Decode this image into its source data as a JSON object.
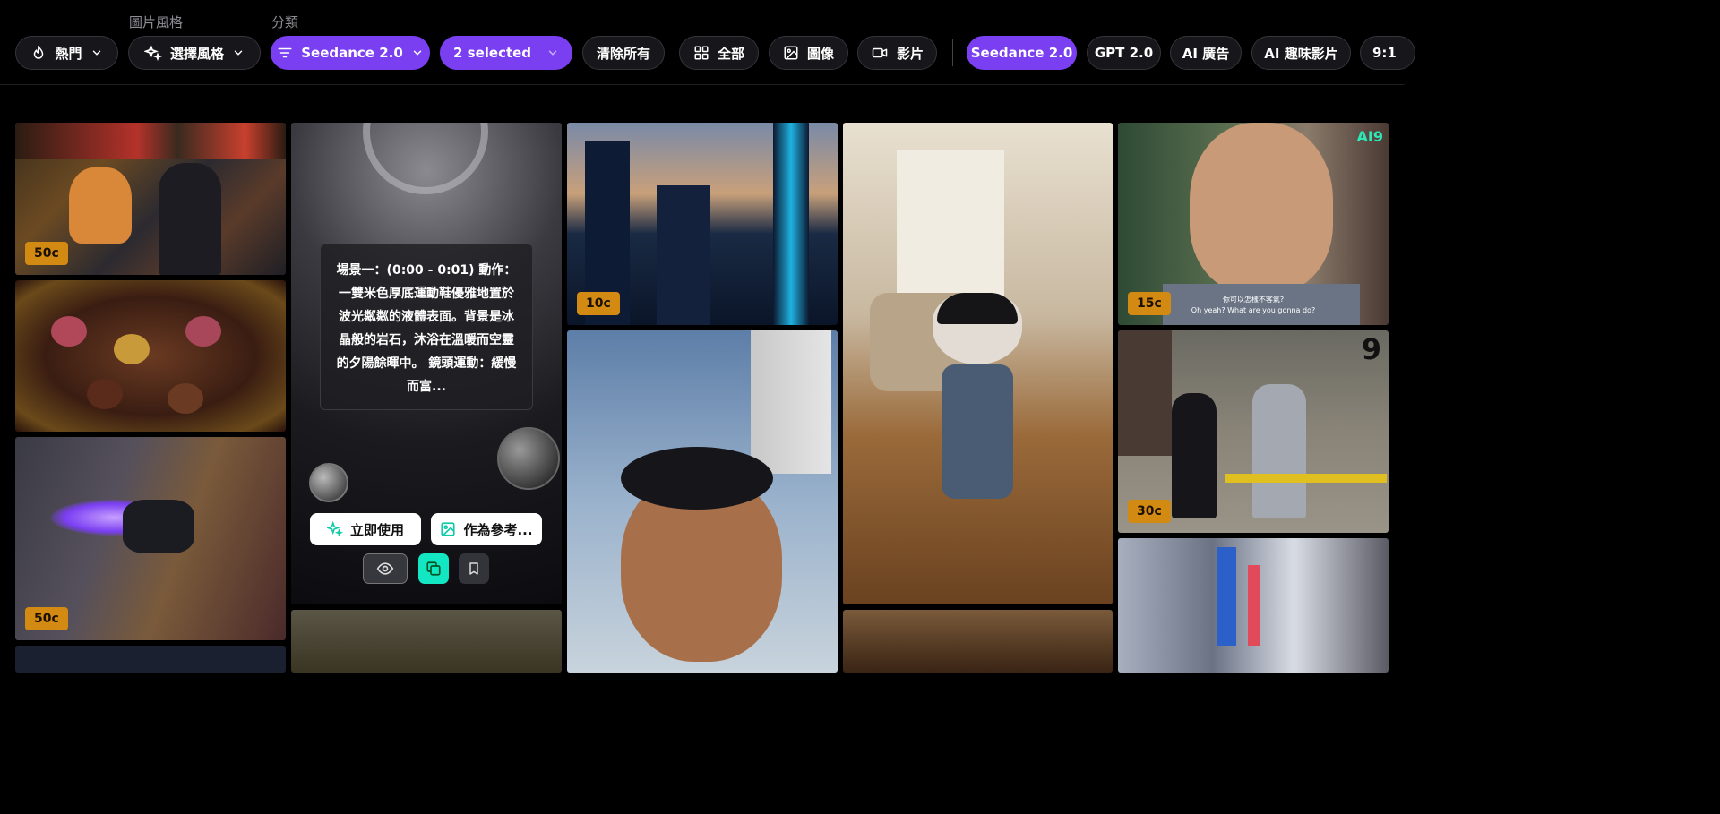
{
  "filters": {
    "style_group_label": "圖片風格",
    "category_group_label": "分類",
    "sort_label": "熱門",
    "style_select_label": "選擇風格",
    "model_select_label": "Seedance 2.0",
    "multi_select_label": "2 selected",
    "clear_all_label": "清除所有",
    "type_all_label": "全部",
    "type_image_label": "圖像",
    "type_video_label": "影片",
    "tags": [
      "Seedance 2.0",
      "GPT 2.0",
      "AI 廣告",
      "AI 趣味影片",
      "9:1"
    ]
  },
  "colors": {
    "accent": "#7b3ff2",
    "teal": "#12e6c3",
    "badge": "#d38a12"
  },
  "tiles": {
    "night_market_cat": {
      "cost": "50c"
    },
    "chocolates": {},
    "speed_runner": {
      "cost": "50c"
    },
    "city_tower": {
      "cost": "10c"
    },
    "cliff_climber": {},
    "dancing_cat": {},
    "monk_closeup": {
      "cost": "15c",
      "watermark": "AI9",
      "subtitle_cn": "你可以怎樣不客氣?",
      "subtitle_en": "Oh yeah? What are you gonna do?"
    },
    "street_fight": {
      "cost": "30c",
      "watermark": "9"
    },
    "bubbles_hover": {
      "prompt": "場景一：(0:00 - 0:01) 動作：一雙米色厚底運動鞋優雅地置於波光粼粼的液體表面。背景是冰晶般的岩石，沐浴在溫暖而空靈的夕陽餘暉中。 鏡頭運動：緩慢而富...",
      "use_now_label": "立即使用",
      "use_as_ref_label": "作為參考..."
    }
  },
  "icons": [
    "flame-icon",
    "sparkle-icon",
    "filter-icon",
    "chevron-down-icon",
    "grid-icon",
    "image-icon",
    "video-icon",
    "eye-icon",
    "copy-icon",
    "bookmark-icon"
  ]
}
